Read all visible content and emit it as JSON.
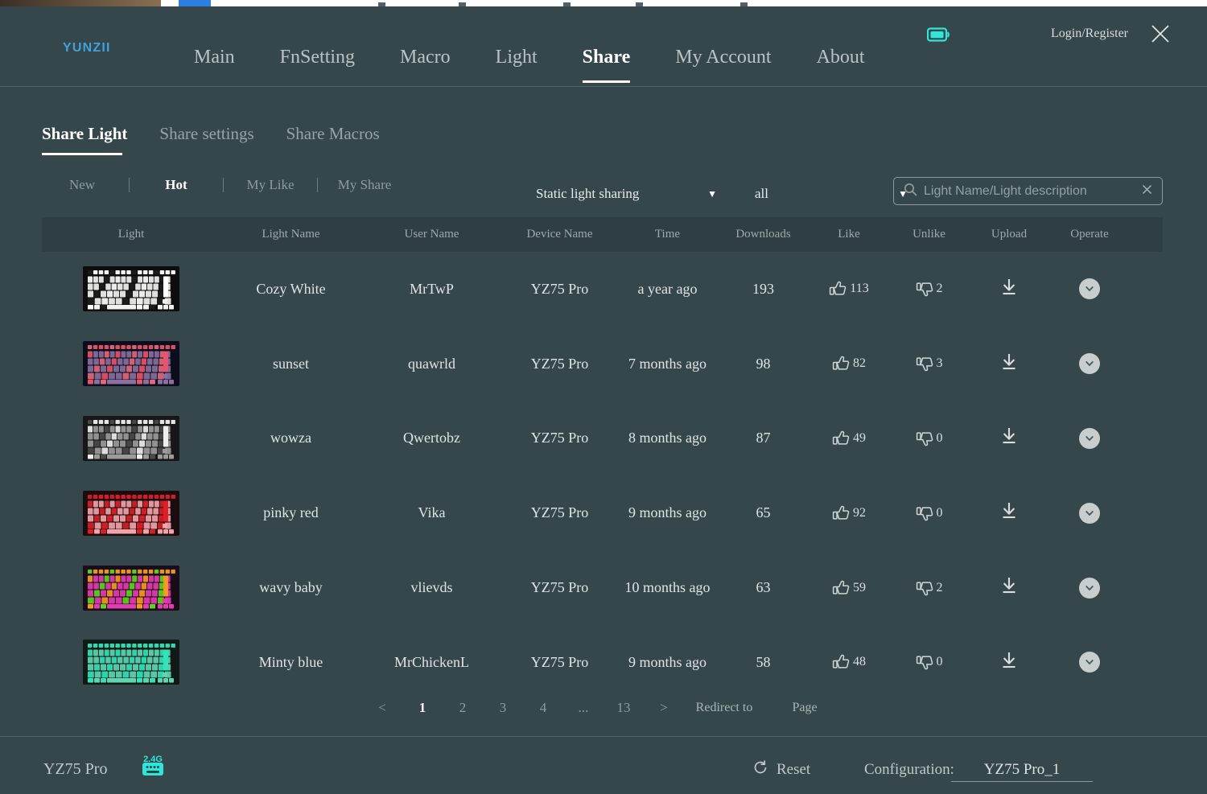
{
  "window": {
    "brand": "YUNZII",
    "login_label": "Login/Register",
    "close_icon": "close-icon",
    "battery_icon": "battery-icon",
    "battery_color": "#2fe6d8"
  },
  "mainnav": {
    "items": [
      {
        "label": "Main",
        "active": false
      },
      {
        "label": "FnSetting",
        "active": false
      },
      {
        "label": "Macro",
        "active": false
      },
      {
        "label": "Light",
        "active": false
      },
      {
        "label": "Share",
        "active": true
      },
      {
        "label": "My Account",
        "active": false
      },
      {
        "label": "About",
        "active": false
      }
    ]
  },
  "subtabs": {
    "items": [
      {
        "label": "Share Light",
        "active": true
      },
      {
        "label": "Share settings",
        "active": false
      },
      {
        "label": "Share Macros",
        "active": false
      }
    ]
  },
  "filters": {
    "sort_items": [
      {
        "label": "New",
        "active": false
      },
      {
        "label": "Hot",
        "active": true
      },
      {
        "label": "My Like",
        "active": false
      },
      {
        "label": "My Share",
        "active": false
      }
    ],
    "type_dropdown": {
      "value": "Static light sharing",
      "caret": "chevron-down-icon"
    },
    "scope_dropdown": {
      "value": "all",
      "caret": "chevron-down-icon"
    },
    "search": {
      "value": "",
      "placeholder": "Light Name/Light description",
      "search_icon": "search-icon",
      "clear_icon": "clear-icon"
    }
  },
  "table": {
    "headers": [
      "Light",
      "Light Name",
      "User Name",
      "Device Name",
      "Time",
      "Downloads",
      "Like",
      "Unlike",
      "Upload",
      "Operate"
    ],
    "rows": [
      {
        "light_name": "Cozy White",
        "user_name": "MrTwP",
        "device_name": "YZ75 Pro",
        "time": "a year ago",
        "downloads": "193",
        "like": "113",
        "unlike": "2",
        "theme": "cozy-white"
      },
      {
        "light_name": "sunset",
        "user_name": "quawrld",
        "device_name": "YZ75 Pro",
        "time": "7 months ago",
        "downloads": "98",
        "like": "82",
        "unlike": "3",
        "theme": "sunset"
      },
      {
        "light_name": "wowza",
        "user_name": "Qwertobz",
        "device_name": "YZ75 Pro",
        "time": "8 months ago",
        "downloads": "87",
        "like": "49",
        "unlike": "0",
        "theme": "wowza"
      },
      {
        "light_name": "pinky red",
        "user_name": "Vika",
        "device_name": "YZ75 Pro",
        "time": "9 months ago",
        "downloads": "65",
        "like": "92",
        "unlike": "0",
        "theme": "pinky-red"
      },
      {
        "light_name": "wavy baby",
        "user_name": "vlievds",
        "device_name": "YZ75 Pro",
        "time": "10 months ago",
        "downloads": "63",
        "like": "59",
        "unlike": "2",
        "theme": "wavy-baby"
      },
      {
        "light_name": "Minty blue",
        "user_name": "MrChickenL",
        "device_name": "YZ75 Pro",
        "time": "9 months ago",
        "downloads": "58",
        "like": "48",
        "unlike": "0",
        "theme": "minty-blue"
      }
    ]
  },
  "pagination": {
    "prev": "<",
    "next": ">",
    "pages": [
      {
        "label": "1",
        "active": true
      },
      {
        "label": "2",
        "active": false
      },
      {
        "label": "3",
        "active": false
      },
      {
        "label": "4",
        "active": false
      },
      {
        "label": "...",
        "active": false,
        "ellipsis": true
      },
      {
        "label": "13",
        "active": false
      }
    ],
    "redirect_label": "Redirect to",
    "page_label": "Page"
  },
  "footer": {
    "device_name": "YZ75 Pro",
    "connection_icon": "keyboard-24g-icon",
    "connection_label": "2.4G",
    "connection_color": "#2fe6d8",
    "reset_label": "Reset",
    "reset_icon": "refresh-icon",
    "configuration_label": "Configuration:",
    "configuration_value": "YZ75 Pro_1"
  },
  "thumbnails": {
    "cozy-white": {
      "bg": "#0d0d0d",
      "key": "#f2f2f0",
      "accent": "#ffffff",
      "row1": "#1d1d1d"
    },
    "sunset": {
      "bg": "#0b0d1c",
      "key": "#8a6fa0",
      "accent": "#e8546a",
      "row1": "#e4677d"
    },
    "wowza": {
      "bg": "#171717",
      "key": "#9c9c9c",
      "accent": "#efefef",
      "row1": "#4a4a4a"
    },
    "pinky-red": {
      "bg": "#1a0d10",
      "key": "#f4a3a8",
      "accent": "#e01e28",
      "row1": "#d41f27"
    },
    "wavy-baby": {
      "bg": "#190d1a",
      "key": "#e53bb0",
      "accent": "#f59a1e",
      "row1": "#5fd41e"
    },
    "minty-blue": {
      "bg": "#111a18",
      "key": "#5fd6b2",
      "accent": "#2fe6b8",
      "row1": "#36e0b6"
    }
  }
}
